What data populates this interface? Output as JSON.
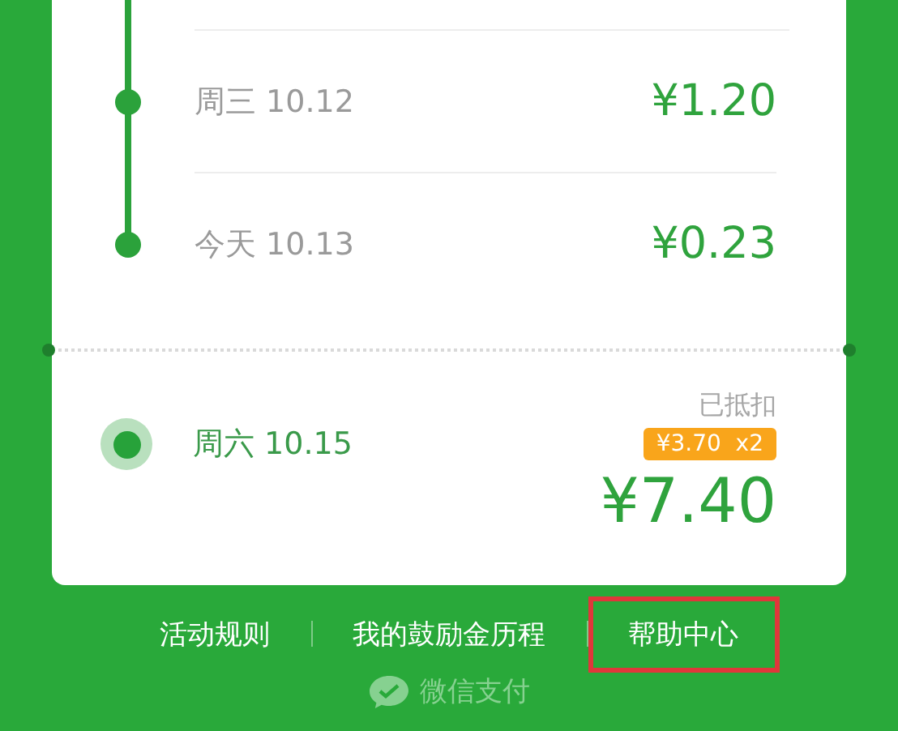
{
  "days": [
    {
      "label": "周三 10.12",
      "amount": "¥1.20",
      "selected": false
    },
    {
      "label": "今天 10.13",
      "amount": "¥0.23",
      "selected": false
    },
    {
      "label": "周六 10.15",
      "amount": "¥7.40",
      "selected": true,
      "status": "已抵扣",
      "badge": "¥3.70  x2"
    }
  ],
  "footer_links": [
    {
      "label": "活动规则",
      "highlighted": false
    },
    {
      "label": "我的鼓励金历程",
      "highlighted": false
    },
    {
      "label": "帮助中心",
      "highlighted": true
    }
  ],
  "brand": "微信支付"
}
